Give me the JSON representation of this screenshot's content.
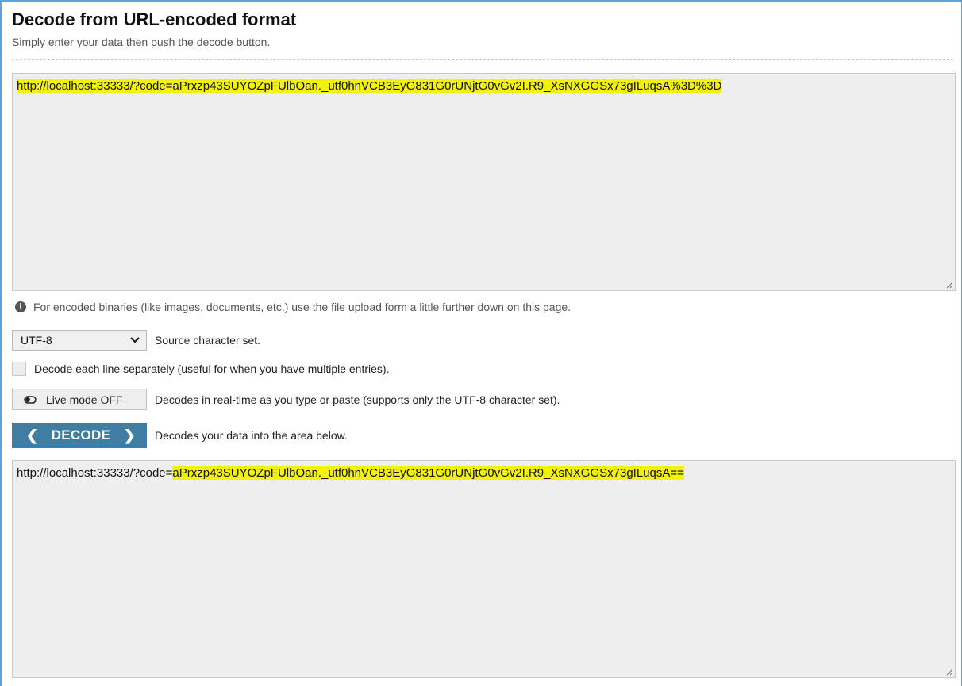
{
  "header": {
    "title": "Decode from URL-encoded format",
    "subtitle": "Simply enter your data then push the decode button."
  },
  "input": {
    "text_prefix": "",
    "text_highlight": "http://localhost:33333/?code=aPrxzp43SUYOZpFUlbOan._utf0hnVCB3EyG831G0rUNjtG0vGv2I.R9_XsNXGGSx73gILuqsA%3D%3D"
  },
  "info_note": "For encoded binaries (like images, documents, etc.) use the file upload form a little further down on this page.",
  "charset": {
    "selected": "UTF-8",
    "label": "Source character set."
  },
  "each_line": {
    "label": "Decode each line separately (useful for when you have multiple entries)."
  },
  "live_mode": {
    "button_label": "Live mode OFF",
    "description": "Decodes in real-time as you type or paste (supports only the UTF-8 character set)."
  },
  "decode": {
    "button_label": "DECODE",
    "description": "Decodes your data into the area below."
  },
  "output": {
    "text_prefix": "http://localhost:33333/?code=",
    "text_highlight": "aPrxzp43SUYOZpFUlbOan._utf0hnVCB3EyG831G0rUNjtG0vGv2I.R9_XsNXGGSx73gILuqsA=="
  },
  "colors": {
    "accent": "#3f7da2",
    "highlight": "#f2f20a"
  }
}
